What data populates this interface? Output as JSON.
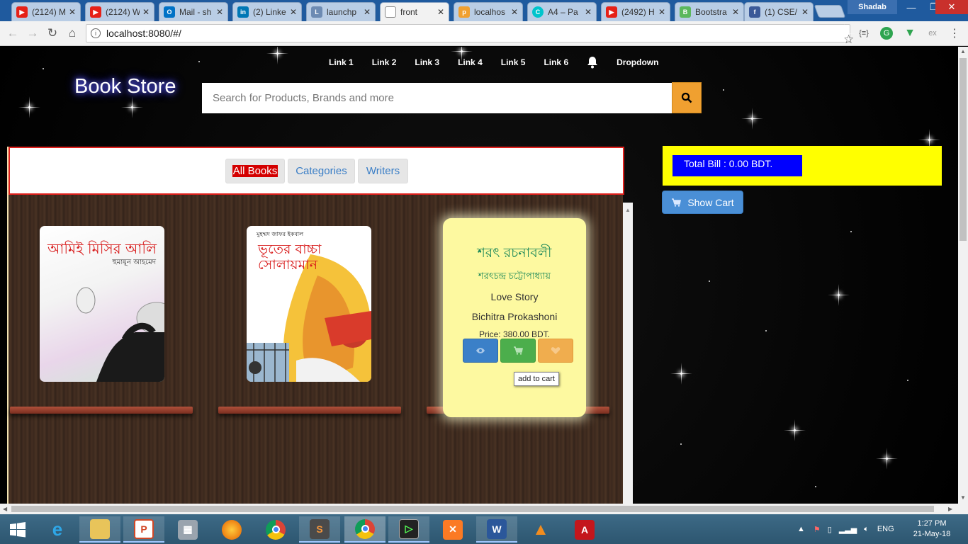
{
  "browser": {
    "tabs": [
      {
        "title": "(2124) M",
        "icon": "youtube-icon",
        "color": "#e62117",
        "active": false
      },
      {
        "title": "(2124) W",
        "icon": "youtube-icon",
        "color": "#e62117",
        "active": false
      },
      {
        "title": "Mail - sh",
        "icon": "outlook-icon",
        "color": "#0072c6",
        "active": false
      },
      {
        "title": "(2) Linke",
        "icon": "linkedin-icon",
        "color": "#0077b5",
        "active": false
      },
      {
        "title": "launchp",
        "icon": "launchpad-icon",
        "color": "#6d8bb3",
        "active": false
      },
      {
        "title": "front",
        "icon": "page-icon",
        "color": "#777777",
        "active": true
      },
      {
        "title": "localhos",
        "icon": "phpmyadmin-icon",
        "color": "#f0a030",
        "active": false
      },
      {
        "title": "A4 – Pa",
        "icon": "canva-icon",
        "color": "#00c4cc",
        "active": false
      },
      {
        "title": "(2492) H",
        "icon": "youtube-icon",
        "color": "#e62117",
        "active": false
      },
      {
        "title": "Bootstra",
        "icon": "bootstrap-icon",
        "color": "#5cb85c",
        "active": false
      },
      {
        "title": "(1) CSE/",
        "icon": "facebook-icon",
        "color": "#3b5998",
        "active": false
      }
    ],
    "profile_name": "Shadab",
    "url": "localhost:8080/#/"
  },
  "site": {
    "nav_links": [
      "Link 1",
      "Link 2",
      "Link 3",
      "Link 4",
      "Link 5",
      "Link 6"
    ],
    "dropdown_label": "Dropdown",
    "brand": "Book Store",
    "search_placeholder": "Search for Products, Brands and more",
    "filter_tabs": [
      "All Books",
      "Categories",
      "Writers"
    ],
    "active_filter": "All Books",
    "books": [
      {
        "cover_title": "আমিই মিসির আলি",
        "cover_author": "হুমায়ূন আহমেদ"
      },
      {
        "cover_title": "ভূতের বাচ্চা সোলায়মান",
        "cover_author": "মুহম্মদ জাফর ইকবাল"
      }
    ],
    "hover_card": {
      "name": "শরৎ রচনাবলী",
      "author": "শরৎচন্দ্র চট্টোপাধ্যায়",
      "category": "Love Story",
      "publisher": "Bichitra Prokashoni",
      "price": "Price: 380.00 BDT."
    },
    "tooltip": "add to cart",
    "total_bill": "Total Bill : 0.00 BDT.",
    "cart_button": "Show Cart",
    "colors": {
      "bill_bg": "#ffff00",
      "bill_inner": "#0000ff",
      "search_btn": "#f0a030",
      "cart_btn": "#4a8fd6",
      "active_tab": "#d40000"
    }
  },
  "taskbar": {
    "apps": [
      "start",
      "internet-explorer",
      "file-explorer",
      "powerpoint",
      "calculator",
      "firefox",
      "chrome",
      "sublime-text",
      "chrome-apps",
      "terminal",
      "xampp",
      "word",
      "vlc",
      "acrobat"
    ],
    "language": "ENG",
    "time": "1:27 PM",
    "date": "21-May-18"
  }
}
